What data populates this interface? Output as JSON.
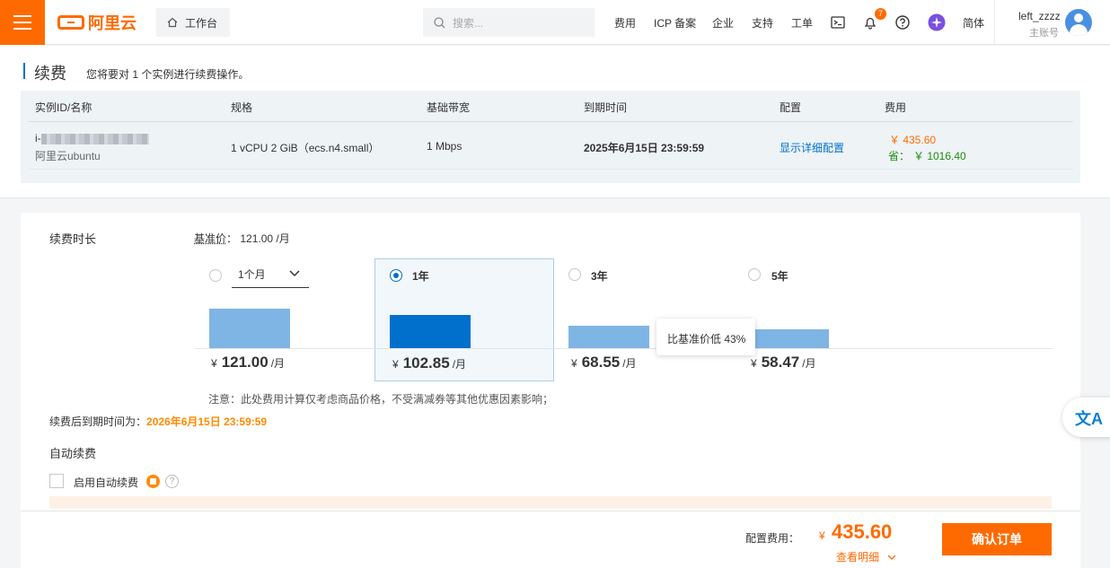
{
  "header": {
    "brand": "阿里云",
    "workbench": "工作台",
    "search_placeholder": "搜索...",
    "nav": [
      "费用",
      "ICP 备案",
      "企业",
      "支持",
      "工单"
    ],
    "notify_count": "7",
    "lang": "简体",
    "user_name": "left_zzzz",
    "user_role": "主账号",
    "icons": [
      "terminal-icon",
      "bell-icon",
      "help-icon",
      "ai-assistant-icon"
    ]
  },
  "page": {
    "title": "续费",
    "subtitle": "您将要对 1 个实例进行续费操作。"
  },
  "table": {
    "headers": [
      "实例ID/名称",
      "规格",
      "基础带宽",
      "到期时间",
      "配置",
      "费用"
    ],
    "row": {
      "instance_id_prefix": "i-",
      "instance_name": "阿里云ubuntu",
      "spec": "1 vCPU 2 GiB（ecs.n4.small）",
      "bandwidth": "1 Mbps",
      "expire": "2025年6月15日 23:59:59",
      "config_link": "显示详细配置",
      "fee": "￥ 435.60",
      "save_label": "省：",
      "save": "￥ 1016.40"
    }
  },
  "renew": {
    "duration_label": "续费时长",
    "base_price_label": "基准价",
    "base_price": "：  121.00 /月",
    "options": [
      {
        "label": "1个月",
        "price": "121.00",
        "unit": "/月",
        "selected": false
      },
      {
        "label": "1年",
        "price": "102.85",
        "unit": "/月",
        "selected": true
      },
      {
        "label": "3年",
        "price": "68.55",
        "unit": "/月",
        "selected": false
      },
      {
        "label": "5年",
        "price": "58.47",
        "unit": "/月",
        "selected": false
      }
    ],
    "yen": "¥",
    "tooltip": "比基准价低 43%",
    "note": "注意：此处费用计算仅考虑商品价格，不受满减券等其他优惠因素影响；",
    "expire_label": "续费后到期时间为：",
    "expire_value": "2026年6月15日 23:59:59",
    "auto_title": "自动续费",
    "auto_label": "启用自动续费"
  },
  "footer": {
    "cost_label": "配置费用：",
    "yen": "¥",
    "cost": "435.60",
    "detail": "查看明细",
    "confirm": "确认订单"
  },
  "colors": {
    "brand": "#ff6a00",
    "link": "#0070cc",
    "bar_selected": "#0070cc",
    "bar": "#7fb5e4",
    "save_green": "#1f8b0e"
  }
}
